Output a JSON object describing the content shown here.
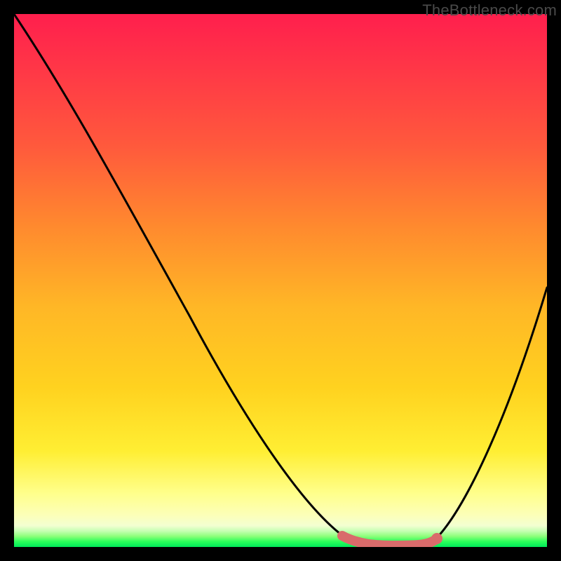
{
  "watermark": {
    "text": "TheBottleneck.com"
  },
  "chart_data": {
    "type": "line",
    "title": "",
    "xlabel": "",
    "ylabel": "",
    "xlim": [
      0,
      100
    ],
    "ylim": [
      0,
      100
    ],
    "series": [
      {
        "name": "bottleneck-curve",
        "x": [
          0,
          5,
          10,
          15,
          20,
          25,
          30,
          35,
          40,
          45,
          50,
          55,
          60,
          63,
          66,
          70,
          73,
          76,
          80,
          85,
          90,
          95,
          100
        ],
        "values": [
          100,
          93,
          86,
          79,
          71,
          63,
          55,
          47,
          39,
          31,
          23,
          15,
          8,
          3,
          1,
          0,
          0,
          0,
          1,
          7,
          18,
          33,
          52
        ]
      }
    ],
    "annotations": [
      {
        "name": "valley-highlight",
        "x_start": 62,
        "x_end": 79,
        "y": 0,
        "color": "#d96b6b"
      }
    ]
  }
}
